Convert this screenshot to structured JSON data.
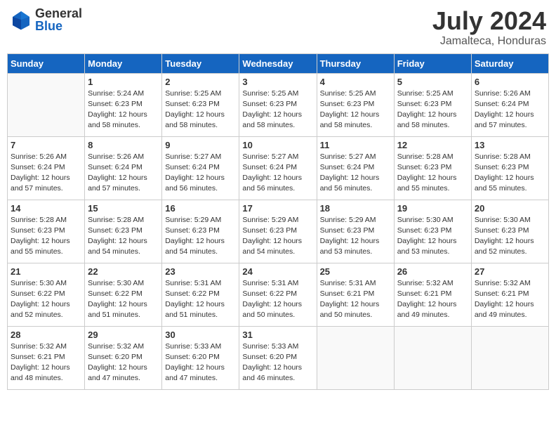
{
  "header": {
    "logo_general": "General",
    "logo_blue": "Blue",
    "month": "July 2024",
    "location": "Jamalteca, Honduras"
  },
  "weekdays": [
    "Sunday",
    "Monday",
    "Tuesday",
    "Wednesday",
    "Thursday",
    "Friday",
    "Saturday"
  ],
  "weeks": [
    [
      {
        "day": "",
        "sunrise": "",
        "sunset": "",
        "daylight": ""
      },
      {
        "day": "1",
        "sunrise": "Sunrise: 5:24 AM",
        "sunset": "Sunset: 6:23 PM",
        "daylight": "Daylight: 12 hours and 58 minutes."
      },
      {
        "day": "2",
        "sunrise": "Sunrise: 5:25 AM",
        "sunset": "Sunset: 6:23 PM",
        "daylight": "Daylight: 12 hours and 58 minutes."
      },
      {
        "day": "3",
        "sunrise": "Sunrise: 5:25 AM",
        "sunset": "Sunset: 6:23 PM",
        "daylight": "Daylight: 12 hours and 58 minutes."
      },
      {
        "day": "4",
        "sunrise": "Sunrise: 5:25 AM",
        "sunset": "Sunset: 6:23 PM",
        "daylight": "Daylight: 12 hours and 58 minutes."
      },
      {
        "day": "5",
        "sunrise": "Sunrise: 5:25 AM",
        "sunset": "Sunset: 6:23 PM",
        "daylight": "Daylight: 12 hours and 58 minutes."
      },
      {
        "day": "6",
        "sunrise": "Sunrise: 5:26 AM",
        "sunset": "Sunset: 6:24 PM",
        "daylight": "Daylight: 12 hours and 57 minutes."
      }
    ],
    [
      {
        "day": "7",
        "sunrise": "Sunrise: 5:26 AM",
        "sunset": "Sunset: 6:24 PM",
        "daylight": "Daylight: 12 hours and 57 minutes."
      },
      {
        "day": "8",
        "sunrise": "Sunrise: 5:26 AM",
        "sunset": "Sunset: 6:24 PM",
        "daylight": "Daylight: 12 hours and 57 minutes."
      },
      {
        "day": "9",
        "sunrise": "Sunrise: 5:27 AM",
        "sunset": "Sunset: 6:24 PM",
        "daylight": "Daylight: 12 hours and 56 minutes."
      },
      {
        "day": "10",
        "sunrise": "Sunrise: 5:27 AM",
        "sunset": "Sunset: 6:24 PM",
        "daylight": "Daylight: 12 hours and 56 minutes."
      },
      {
        "day": "11",
        "sunrise": "Sunrise: 5:27 AM",
        "sunset": "Sunset: 6:24 PM",
        "daylight": "Daylight: 12 hours and 56 minutes."
      },
      {
        "day": "12",
        "sunrise": "Sunrise: 5:28 AM",
        "sunset": "Sunset: 6:23 PM",
        "daylight": "Daylight: 12 hours and 55 minutes."
      },
      {
        "day": "13",
        "sunrise": "Sunrise: 5:28 AM",
        "sunset": "Sunset: 6:23 PM",
        "daylight": "Daylight: 12 hours and 55 minutes."
      }
    ],
    [
      {
        "day": "14",
        "sunrise": "Sunrise: 5:28 AM",
        "sunset": "Sunset: 6:23 PM",
        "daylight": "Daylight: 12 hours and 55 minutes."
      },
      {
        "day": "15",
        "sunrise": "Sunrise: 5:28 AM",
        "sunset": "Sunset: 6:23 PM",
        "daylight": "Daylight: 12 hours and 54 minutes."
      },
      {
        "day": "16",
        "sunrise": "Sunrise: 5:29 AM",
        "sunset": "Sunset: 6:23 PM",
        "daylight": "Daylight: 12 hours and 54 minutes."
      },
      {
        "day": "17",
        "sunrise": "Sunrise: 5:29 AM",
        "sunset": "Sunset: 6:23 PM",
        "daylight": "Daylight: 12 hours and 54 minutes."
      },
      {
        "day": "18",
        "sunrise": "Sunrise: 5:29 AM",
        "sunset": "Sunset: 6:23 PM",
        "daylight": "Daylight: 12 hours and 53 minutes."
      },
      {
        "day": "19",
        "sunrise": "Sunrise: 5:30 AM",
        "sunset": "Sunset: 6:23 PM",
        "daylight": "Daylight: 12 hours and 53 minutes."
      },
      {
        "day": "20",
        "sunrise": "Sunrise: 5:30 AM",
        "sunset": "Sunset: 6:23 PM",
        "daylight": "Daylight: 12 hours and 52 minutes."
      }
    ],
    [
      {
        "day": "21",
        "sunrise": "Sunrise: 5:30 AM",
        "sunset": "Sunset: 6:22 PM",
        "daylight": "Daylight: 12 hours and 52 minutes."
      },
      {
        "day": "22",
        "sunrise": "Sunrise: 5:30 AM",
        "sunset": "Sunset: 6:22 PM",
        "daylight": "Daylight: 12 hours and 51 minutes."
      },
      {
        "day": "23",
        "sunrise": "Sunrise: 5:31 AM",
        "sunset": "Sunset: 6:22 PM",
        "daylight": "Daylight: 12 hours and 51 minutes."
      },
      {
        "day": "24",
        "sunrise": "Sunrise: 5:31 AM",
        "sunset": "Sunset: 6:22 PM",
        "daylight": "Daylight: 12 hours and 50 minutes."
      },
      {
        "day": "25",
        "sunrise": "Sunrise: 5:31 AM",
        "sunset": "Sunset: 6:21 PM",
        "daylight": "Daylight: 12 hours and 50 minutes."
      },
      {
        "day": "26",
        "sunrise": "Sunrise: 5:32 AM",
        "sunset": "Sunset: 6:21 PM",
        "daylight": "Daylight: 12 hours and 49 minutes."
      },
      {
        "day": "27",
        "sunrise": "Sunrise: 5:32 AM",
        "sunset": "Sunset: 6:21 PM",
        "daylight": "Daylight: 12 hours and 49 minutes."
      }
    ],
    [
      {
        "day": "28",
        "sunrise": "Sunrise: 5:32 AM",
        "sunset": "Sunset: 6:21 PM",
        "daylight": "Daylight: 12 hours and 48 minutes."
      },
      {
        "day": "29",
        "sunrise": "Sunrise: 5:32 AM",
        "sunset": "Sunset: 6:20 PM",
        "daylight": "Daylight: 12 hours and 47 minutes."
      },
      {
        "day": "30",
        "sunrise": "Sunrise: 5:33 AM",
        "sunset": "Sunset: 6:20 PM",
        "daylight": "Daylight: 12 hours and 47 minutes."
      },
      {
        "day": "31",
        "sunrise": "Sunrise: 5:33 AM",
        "sunset": "Sunset: 6:20 PM",
        "daylight": "Daylight: 12 hours and 46 minutes."
      },
      {
        "day": "",
        "sunrise": "",
        "sunset": "",
        "daylight": ""
      },
      {
        "day": "",
        "sunrise": "",
        "sunset": "",
        "daylight": ""
      },
      {
        "day": "",
        "sunrise": "",
        "sunset": "",
        "daylight": ""
      }
    ]
  ]
}
